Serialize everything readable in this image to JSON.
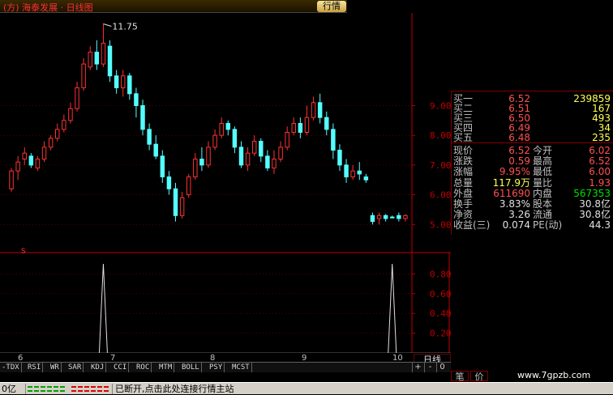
{
  "title_bar": {
    "left_text": "(方) 海泰发展 · 日线图",
    "quote_tab": "行情"
  },
  "chart_data": {
    "type": "candlestick",
    "max_marker": "11.75",
    "y_ticks": [
      "9.00",
      "8.00",
      "7.00",
      "6.00",
      "5.00"
    ],
    "y_range": [
      4.6,
      11.9
    ],
    "x_ticks": [
      "6",
      "7",
      "8",
      "9",
      "10"
    ],
    "indicator_y_ticks": [
      "0.80",
      "0.60",
      "0.40",
      "0.20"
    ],
    "indicator_range": [
      0,
      1
    ],
    "indicator_marker": "S",
    "candles": [
      [
        6.2,
        6.8,
        6.1,
        6.9,
        "up"
      ],
      [
        6.8,
        7.1,
        6.5,
        7.3,
        "up"
      ],
      [
        7.2,
        7.4,
        7.0,
        7.6,
        "up"
      ],
      [
        7.3,
        7.0,
        6.9,
        7.4,
        "down"
      ],
      [
        6.9,
        7.2,
        6.8,
        7.3,
        "up"
      ],
      [
        7.2,
        7.6,
        7.1,
        7.8,
        "up"
      ],
      [
        7.6,
        7.9,
        7.5,
        8.0,
        "up"
      ],
      [
        7.9,
        8.2,
        7.8,
        8.4,
        "up"
      ],
      [
        8.2,
        8.5,
        8.1,
        8.7,
        "up"
      ],
      [
        8.5,
        8.9,
        8.4,
        9.1,
        "up"
      ],
      [
        8.9,
        9.6,
        8.8,
        9.8,
        "up"
      ],
      [
        9.6,
        10.4,
        9.5,
        10.6,
        "up"
      ],
      [
        10.3,
        10.8,
        10.2,
        11.0,
        "up"
      ],
      [
        10.8,
        10.4,
        10.2,
        11.2,
        "down"
      ],
      [
        10.4,
        11.1,
        10.3,
        11.75,
        "up"
      ],
      [
        11.0,
        10.0,
        9.8,
        11.2,
        "down"
      ],
      [
        10.0,
        9.6,
        9.4,
        10.2,
        "down"
      ],
      [
        9.6,
        10.0,
        9.3,
        10.2,
        "up"
      ],
      [
        10.0,
        9.4,
        9.2,
        10.1,
        "down"
      ],
      [
        9.4,
        9.0,
        8.6,
        9.6,
        "down"
      ],
      [
        9.0,
        8.2,
        8.0,
        9.2,
        "down"
      ],
      [
        8.2,
        7.7,
        7.5,
        8.4,
        "down"
      ],
      [
        7.7,
        7.3,
        7.2,
        8.0,
        "down"
      ],
      [
        7.3,
        6.6,
        6.4,
        7.5,
        "down"
      ],
      [
        6.6,
        6.2,
        6.0,
        6.8,
        "down"
      ],
      [
        6.2,
        5.3,
        5.1,
        6.4,
        "down"
      ],
      [
        5.3,
        5.9,
        5.2,
        6.1,
        "up"
      ],
      [
        6.0,
        6.6,
        5.9,
        6.7,
        "up"
      ],
      [
        6.6,
        7.2,
        6.5,
        7.4,
        "up"
      ],
      [
        7.2,
        7.0,
        6.8,
        7.6,
        "down"
      ],
      [
        7.0,
        7.6,
        6.9,
        7.8,
        "up"
      ],
      [
        7.6,
        8.0,
        7.5,
        8.2,
        "up"
      ],
      [
        8.0,
        8.4,
        7.9,
        8.6,
        "up"
      ],
      [
        8.4,
        8.2,
        8.0,
        8.5,
        "down"
      ],
      [
        8.2,
        7.6,
        7.4,
        8.3,
        "down"
      ],
      [
        7.6,
        7.0,
        6.9,
        7.8,
        "down"
      ],
      [
        7.0,
        7.4,
        6.8,
        7.6,
        "up"
      ],
      [
        7.4,
        7.8,
        7.3,
        8.0,
        "up"
      ],
      [
        7.8,
        7.3,
        7.1,
        7.9,
        "down"
      ],
      [
        7.3,
        6.9,
        6.8,
        7.5,
        "down"
      ],
      [
        6.9,
        7.2,
        6.7,
        7.5,
        "up"
      ],
      [
        7.2,
        7.6,
        7.1,
        7.8,
        "up"
      ],
      [
        7.6,
        8.1,
        7.5,
        8.3,
        "up"
      ],
      [
        8.1,
        8.4,
        8.0,
        8.6,
        "up"
      ],
      [
        8.4,
        8.1,
        7.9,
        8.6,
        "down"
      ],
      [
        8.1,
        8.6,
        8.0,
        9.0,
        "up"
      ],
      [
        8.6,
        9.1,
        8.5,
        9.3,
        "up"
      ],
      [
        9.1,
        8.6,
        8.4,
        9.4,
        "down"
      ],
      [
        8.6,
        8.2,
        8.0,
        8.8,
        "down"
      ],
      [
        8.2,
        7.5,
        7.2,
        8.4,
        "down"
      ],
      [
        7.5,
        7.0,
        6.8,
        7.7,
        "down"
      ],
      [
        7.0,
        6.6,
        6.4,
        7.2,
        "down"
      ],
      [
        6.6,
        6.8,
        6.5,
        7.0,
        "up"
      ],
      [
        6.8,
        6.7,
        6.5,
        7.1,
        "down"
      ],
      [
        6.6,
        6.5,
        6.4,
        6.7,
        "down"
      ],
      [
        5.3,
        5.1,
        5.0,
        5.4,
        "down"
      ],
      [
        5.2,
        5.3,
        5.0,
        5.4,
        "up"
      ],
      [
        5.3,
        5.2,
        5.1,
        5.35,
        "down"
      ],
      [
        5.25,
        5.25,
        5.2,
        5.3,
        "down"
      ],
      [
        5.3,
        5.2,
        5.1,
        5.4,
        "down"
      ],
      [
        5.2,
        5.3,
        5.1,
        5.35,
        "up"
      ]
    ],
    "indicator_peaks": [
      14,
      58
    ]
  },
  "quote_panel": {
    "rows": [
      {
        "label": "买一",
        "price": "6.52",
        "vol": "239859"
      },
      {
        "label": "买二",
        "price": "6.51",
        "vol": "167"
      },
      {
        "label": "买三",
        "price": "6.50",
        "vol": "493"
      },
      {
        "label": "买四",
        "price": "6.49",
        "vol": "34"
      },
      {
        "label": "买五",
        "price": "6.48",
        "vol": "235"
      }
    ],
    "stats": [
      {
        "l1": "现价",
        "v1": "6.52",
        "l2": "今开",
        "v2": "6.02"
      },
      {
        "l1": "涨跌",
        "v1": "0.59",
        "l2": "最高",
        "v2": "6.52"
      },
      {
        "l1": "涨幅",
        "v1": "9.95%",
        "l2": "最低",
        "v2": "6.00"
      },
      {
        "l1": "总量",
        "v1": "117.9万",
        "l2": "量比",
        "v2": "1.93"
      },
      {
        "l1": "外盘",
        "v1": "611690",
        "l2": "内盘",
        "v2": "567353"
      },
      {
        "l1": "换手",
        "v1": "3.83%",
        "l2": "股本",
        "v2": "30.8亿"
      },
      {
        "l1": "净资",
        "v1": "3.26",
        "l2": "流通",
        "v2": "30.8亿"
      },
      {
        "l1": "收益(三)",
        "v1": "0.074",
        "l2": "PE(动)",
        "v2": "44.3"
      }
    ]
  },
  "period_tab": "日线",
  "indicator_tabs": [
    "TDX",
    "RSI",
    "WR",
    "SAR",
    "KDJ",
    "CCI",
    "ROC",
    "MTM",
    "BOLL",
    "PSY",
    "MCST"
  ],
  "tab_controls": [
    "+",
    "-",
    "0"
  ],
  "side_tabs": [
    "笔",
    "价"
  ],
  "watermark": "www.7gpzb.com",
  "status_bar": {
    "left": "0亿",
    "message": "已断开,点击此处连接行情主站"
  },
  "colors": {
    "up": "#ff3232",
    "down": "#54ffff",
    "axis": "#c00000",
    "grid": "#800000"
  }
}
